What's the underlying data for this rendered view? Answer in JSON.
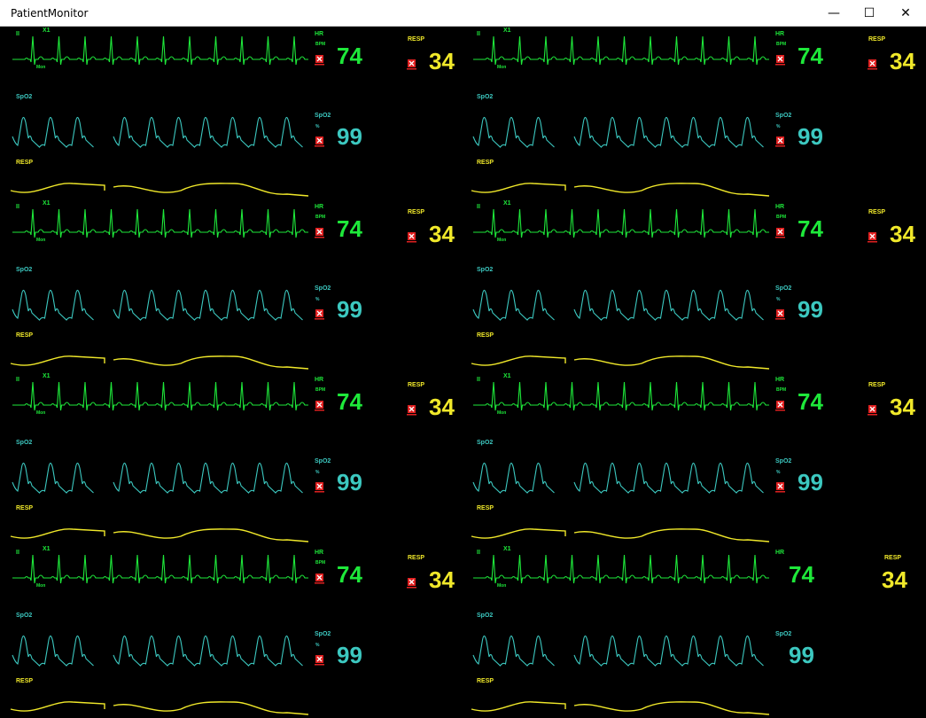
{
  "window": {
    "title": "PatientMonitor",
    "controls": {
      "minimize": "—",
      "maximize": "☐",
      "close": "✕"
    }
  },
  "colors": {
    "ecg": "#1ee83a",
    "spo2": "#3cc8c0",
    "resp": "#f0e82a",
    "alarm": "#e02020",
    "background": "#000000"
  },
  "patients": [
    {
      "lead": "II",
      "gain": "X1",
      "filter": "Mon",
      "hr_label": "HR",
      "hr_unit": "BPM",
      "hr": "74",
      "spo2_wave_label": "SpO2",
      "spo2_label": "SpO2",
      "spo2_unit": "%",
      "spo2": "99",
      "resp_wave_label": "RESP",
      "resp_label": "RESP",
      "resp": "34",
      "alarm_icons": true
    },
    {
      "lead": "II",
      "gain": "X1",
      "filter": "Mon",
      "hr_label": "HR",
      "hr_unit": "BPM",
      "hr": "74",
      "spo2_wave_label": "SpO2",
      "spo2_label": "SpO2",
      "spo2_unit": "%",
      "spo2": "99",
      "resp_wave_label": "RESP",
      "resp_label": "RESP",
      "resp": "34",
      "alarm_icons": true
    },
    {
      "lead": "II",
      "gain": "X1",
      "filter": "Mon",
      "hr_label": "HR",
      "hr_unit": "BPM",
      "hr": "74",
      "spo2_wave_label": "SpO2",
      "spo2_label": "SpO2",
      "spo2_unit": "%",
      "spo2": "99",
      "resp_wave_label": "RESP",
      "resp_label": "RESP",
      "resp": "34",
      "alarm_icons": true
    },
    {
      "lead": "II",
      "gain": "X1",
      "filter": "Mon",
      "hr_label": "HR",
      "hr_unit": "BPM",
      "hr": "74",
      "spo2_wave_label": "SpO2",
      "spo2_label": "SpO2",
      "spo2_unit": "%",
      "spo2": "99",
      "resp_wave_label": "RESP",
      "resp_label": "RESP",
      "resp": "34",
      "alarm_icons": true
    },
    {
      "lead": "II",
      "gain": "X1",
      "filter": "Mon",
      "hr_label": "HR",
      "hr_unit": "BPM",
      "hr": "74",
      "spo2_wave_label": "SpO2",
      "spo2_label": "SpO2",
      "spo2_unit": "%",
      "spo2": "99",
      "resp_wave_label": "RESP",
      "resp_label": "RESP",
      "resp": "34",
      "alarm_icons": true
    },
    {
      "lead": "II",
      "gain": "X1",
      "filter": "Mon",
      "hr_label": "HR",
      "hr_unit": "BPM",
      "hr": "74",
      "spo2_wave_label": "SpO2",
      "spo2_label": "SpO2",
      "spo2_unit": "%",
      "spo2": "99",
      "resp_wave_label": "RESP",
      "resp_label": "RESP",
      "resp": "34",
      "alarm_icons": true
    },
    {
      "lead": "II",
      "gain": "X1",
      "filter": "Mon",
      "hr_label": "HR",
      "hr_unit": "BPM",
      "hr": "74",
      "spo2_wave_label": "SpO2",
      "spo2_label": "SpO2",
      "spo2_unit": "%",
      "spo2": "99",
      "resp_wave_label": "RESP",
      "resp_label": "RESP",
      "resp": "34",
      "alarm_icons": true
    },
    {
      "lead": "II",
      "gain": "X1",
      "filter": "Mon",
      "hr_label": "HR",
      "hr_unit": "",
      "hr": "74",
      "spo2_wave_label": "SpO2",
      "spo2_label": "SpO2",
      "spo2_unit": "",
      "spo2": "99",
      "resp_wave_label": "RESP",
      "resp_label": "RESP",
      "resp": "34",
      "alarm_icons": false
    }
  ]
}
